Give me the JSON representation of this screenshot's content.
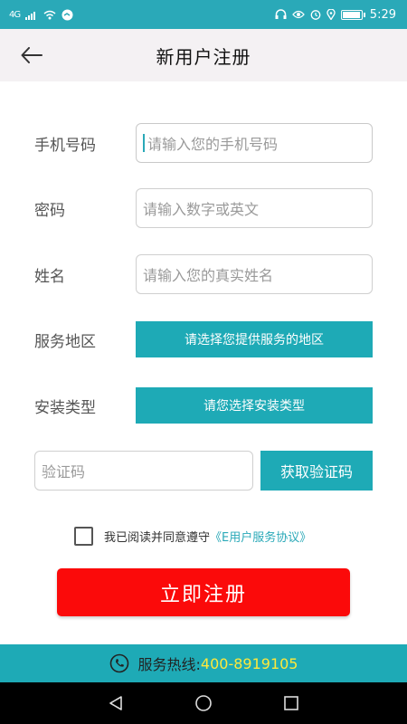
{
  "status_bar": {
    "network": "4G",
    "time": "5:29"
  },
  "header": {
    "title": "新用户注册",
    "back_icon": "arrow-left-icon"
  },
  "form": {
    "phone": {
      "label": "手机号码",
      "placeholder": "请输入您的手机号码"
    },
    "password": {
      "label": "密码",
      "placeholder": "请输入数字或英文"
    },
    "name": {
      "label": "姓名",
      "placeholder": "请输入您的真实姓名"
    },
    "service_area": {
      "label": "服务地区",
      "button": "请选择您提供服务的地区"
    },
    "install_type": {
      "label": "安装类型",
      "button": "请您选择安装类型"
    },
    "verify_code": {
      "placeholder": "验证码",
      "button": "获取验证码"
    },
    "agreement": {
      "text": "我已阅读并同意遵守",
      "link": "《E用户服务协议》",
      "checked": false
    },
    "register_button": "立即注册"
  },
  "hotline": {
    "label": "服务热线:",
    "number": "400-8919105"
  },
  "colors": {
    "accent": "#1eaab6",
    "register": "#fb0a0a",
    "hotline_number": "#ffe93b"
  }
}
